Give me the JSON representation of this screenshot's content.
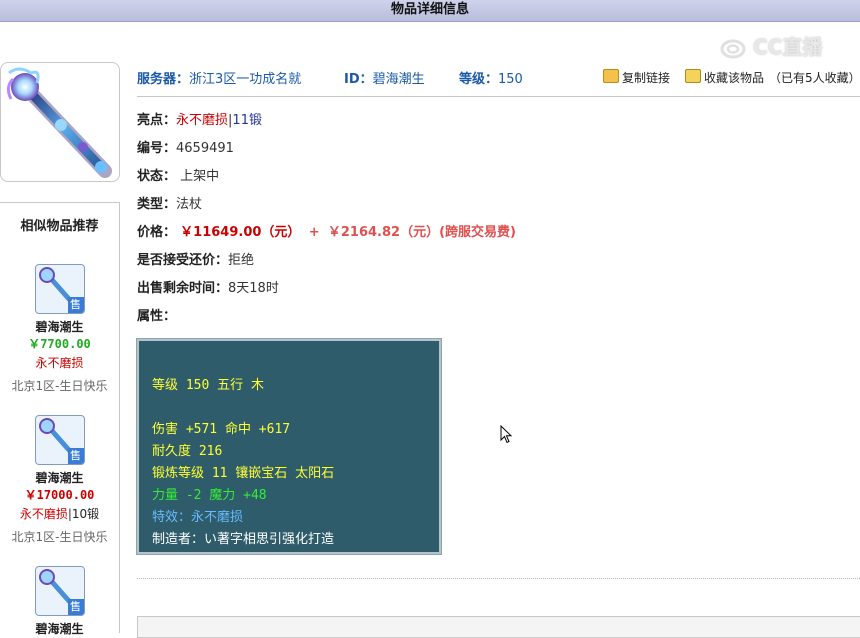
{
  "page": {
    "title": "物品详细信息"
  },
  "watermark": {
    "text": "CC直播"
  },
  "item": {
    "image_icon": "magic-staff-icon",
    "server_label": "服务器：",
    "server_value": "浙江3区一功成名就",
    "id_label": "ID：",
    "id_value": "碧海潮生",
    "level_label": "等级：",
    "level_value": "150"
  },
  "actions": {
    "copy_link": "复制链接",
    "favorite": "收藏该物品",
    "favorite_count": "（已有5人收藏）"
  },
  "details": {
    "highlight_label": "亮点：",
    "highlight_value": "永不磨损",
    "highlight_sep": "|",
    "highlight_extra": "11锻",
    "serial_label": "编号：",
    "serial_value": "4659491",
    "status_label": "状态：",
    "status_value": "上架中",
    "type_label": "类型：",
    "type_value": "法杖",
    "price_label": "价格：",
    "price_value": "￥11649.00（元）",
    "price_plus": "+",
    "price_fee": "￥2164.82（元）(跨服交易费)",
    "bargain_label": "是否接受还价：",
    "bargain_value": "拒绝",
    "time_label": "出售剩余时间：",
    "time_value": "8天18时",
    "attr_label": "属性："
  },
  "attributes": {
    "line1": "等级 150 五行 木",
    "line2": "伤害 +571 命中 +617",
    "line3": "耐久度 216",
    "line4": "锻炼等级 11 镶嵌宝石 太阳石",
    "line5": "力量 -2 魔力 +48",
    "line6": "特效：永不磨损",
    "line7": "制造者：い著字相思引强化打造"
  },
  "similar": {
    "title": "相似物品推荐",
    "sale_badge": "售",
    "items": [
      {
        "name": "碧海潮生",
        "price": "￥7700.00",
        "price_color": "#22aa22",
        "attr": "永不磨损",
        "forge": "",
        "server": "北京1区-生日快乐"
      },
      {
        "name": "碧海潮生",
        "price": "￥17000.00",
        "price_color": "#cc0000",
        "attr": "永不磨损",
        "forge": "10锻",
        "server": "北京1区-生日快乐"
      },
      {
        "name": "碧海潮生",
        "price": "",
        "price_color": "#22aa22",
        "attr": "",
        "forge": "",
        "server": ""
      }
    ]
  },
  "colors": {
    "titlebar": "#c4c8e4",
    "link_blue": "#1a5aa8",
    "price_red": "#cc0000",
    "attr_box_bg": "#2e5c6b",
    "attr_yellow": "#ffff33",
    "attr_green": "#33ee33",
    "attr_blue": "#66bbff"
  }
}
